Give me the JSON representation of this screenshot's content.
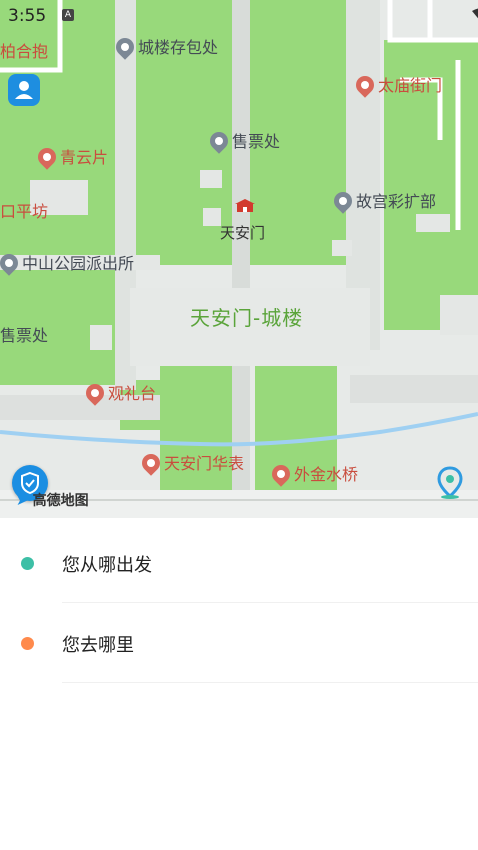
{
  "status": {
    "time": "3:55",
    "indicator": "A"
  },
  "map": {
    "labels": {
      "top_left": "柏合抱",
      "cloakroom": "城楼存包处",
      "taimiao": "太庙街门",
      "qingyun": "青云片",
      "ticket_top": "售票处",
      "palace_photo": "故宫彩扩部",
      "left_cut": "口平坊",
      "gate": "天安门",
      "police": "中山公园派出所",
      "tower": "天安门-城楼",
      "ticket_left": "售票处",
      "guanli": "观礼台",
      "huabiao": "天安门华表",
      "bridge": "外金水桥"
    },
    "logo": "高德地图"
  },
  "route": {
    "from_placeholder": "您从哪出发",
    "to_placeholder": "您去哪里"
  },
  "colors": {
    "start_dot": "#3dbfa6",
    "end_dot": "#ff8a4c",
    "green_area": "#98d97b",
    "accent": "#1b8ee2"
  }
}
